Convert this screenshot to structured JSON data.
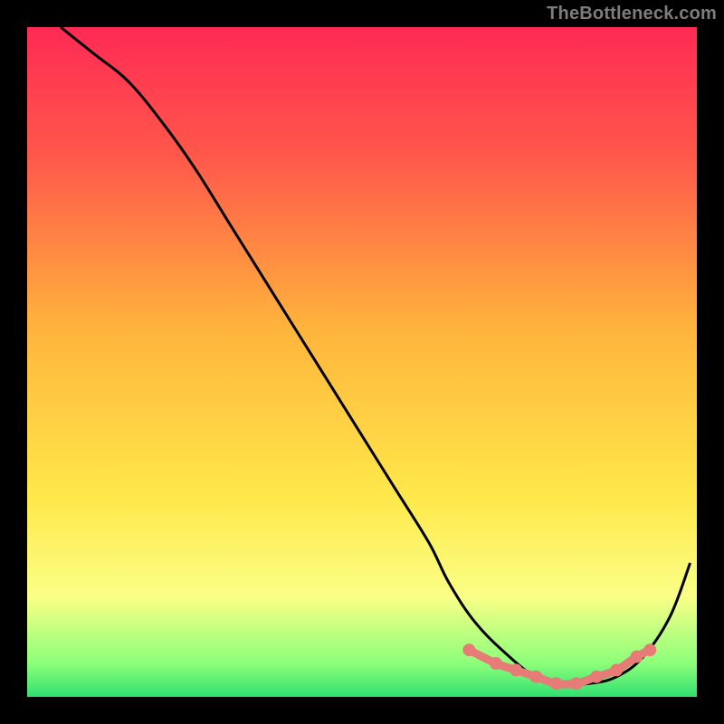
{
  "attribution": "TheBottleneck.com",
  "chart_data": {
    "type": "line",
    "title": "",
    "xlabel": "",
    "ylabel": "",
    "xlim": [
      0,
      100
    ],
    "ylim": [
      0,
      100
    ],
    "grid": false,
    "legend": false,
    "series": [
      {
        "name": "main-curve",
        "color": "#000000",
        "x": [
          5,
          10,
          15,
          20,
          25,
          30,
          35,
          40,
          45,
          50,
          55,
          60,
          63,
          67,
          72,
          76,
          80,
          84,
          88,
          92,
          96,
          99
        ],
        "y": [
          100,
          96,
          92,
          86,
          79,
          71,
          63,
          55,
          47,
          39,
          31,
          23,
          17,
          11,
          6,
          3,
          2,
          2,
          3,
          6,
          12,
          20
        ]
      },
      {
        "name": "highlight-band",
        "color": "#e77b77",
        "x": [
          66,
          70,
          73,
          76,
          79,
          82,
          85,
          88,
          91,
          93
        ],
        "y": [
          7,
          5,
          4,
          3,
          2,
          2,
          3,
          4,
          6,
          7
        ]
      }
    ],
    "gradient_stops": [
      {
        "pos": 0.0,
        "color": "#ff2a55"
      },
      {
        "pos": 0.2,
        "color": "#ff5a4a"
      },
      {
        "pos": 0.45,
        "color": "#ffb43c"
      },
      {
        "pos": 0.7,
        "color": "#ffe84a"
      },
      {
        "pos": 0.85,
        "color": "#faff86"
      },
      {
        "pos": 0.95,
        "color": "#8cff7a"
      },
      {
        "pos": 1.0,
        "color": "#30e070"
      }
    ]
  }
}
